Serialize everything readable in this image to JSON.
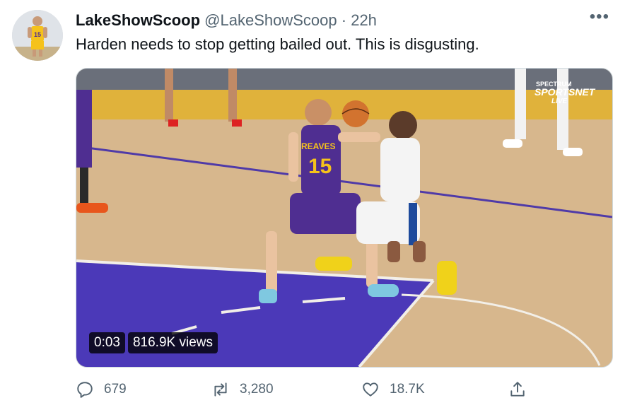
{
  "tweet": {
    "display_name": "LakeShowScoop",
    "handle": "@LakeShowScoop",
    "separator": "·",
    "time": "22h",
    "text": "Harden needs to stop getting bailed out. This is disgusting.",
    "more_icon": "more-icon"
  },
  "media": {
    "video_time": "0:03",
    "views": "816.9K views",
    "watermark_line1": "SPECTRUM",
    "watermark_line2": "SPORTSNET",
    "watermark_line3": "LIVE",
    "jersey_number": "15",
    "jersey_name": "REAVES",
    "colors": {
      "lakers_purple": "#4f2e91",
      "lakers_gold": "#f5c21b",
      "sixers_blue": "#1d4a9c"
    }
  },
  "avatar": {
    "jersey_number": "15"
  },
  "actions": {
    "reply_count": "679",
    "retweet_count": "3,280",
    "like_count": "18.7K",
    "icons": [
      "reply-icon",
      "retweet-icon",
      "like-icon",
      "share-icon"
    ]
  }
}
